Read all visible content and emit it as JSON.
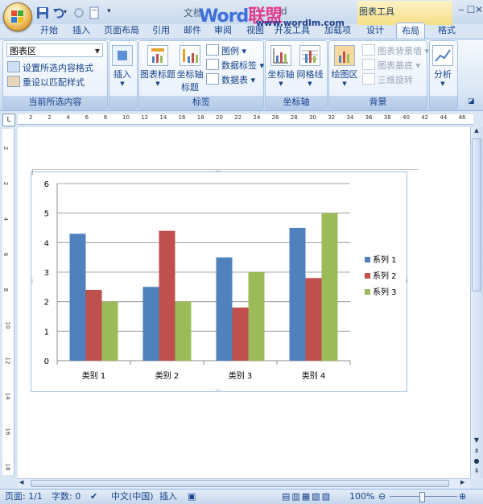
{
  "window": {
    "title": "文档",
    "title_suffix": "d",
    "watermark_a": "Word",
    "watermark_b": "联盟",
    "watermark_url": "www.wordlm.com",
    "contextual_group": "图表工具",
    "controls": [
      "‒",
      "☐",
      "✕"
    ]
  },
  "tabs": [
    {
      "label": "开始"
    },
    {
      "label": "插入"
    },
    {
      "label": "页面布局"
    },
    {
      "label": "引用"
    },
    {
      "label": "邮件"
    },
    {
      "label": "审阅"
    },
    {
      "label": "视图"
    },
    {
      "label": "开发工具"
    },
    {
      "label": "加载项"
    },
    {
      "label": "设计"
    },
    {
      "label": "布局"
    },
    {
      "label": "格式"
    }
  ],
  "ribbon": {
    "current_selection": {
      "combo_value": "图表区",
      "format_selection": "设置所选内容格式",
      "reset_style": "重设以匹配样式",
      "group_label": "当前所选内容"
    },
    "insert": {
      "label": "插入"
    },
    "labels": {
      "chart_title": "图表标题",
      "axis_title_1": "坐标轴",
      "axis_title_2": "标题",
      "legend": "图例",
      "data_labels": "数据标签",
      "data_table": "数据表",
      "group_label": "标签"
    },
    "axes": {
      "axes": "坐标轴",
      "gridlines": "网格线",
      "group_label": "坐标轴"
    },
    "background": {
      "plot_area": "绘图区",
      "chart_wall": "图表背景墙",
      "chart_floor": "图表基底",
      "rotation_3d": "三维旋转",
      "group_label": "背景"
    },
    "analysis": {
      "label": "分析"
    }
  },
  "ruler": {
    "h_ticks": [
      "2",
      "2",
      "4",
      "6",
      "8",
      "10",
      "12",
      "14",
      "16",
      "18",
      "20",
      "22",
      "24",
      "26",
      "28",
      "30",
      "32",
      "34",
      "36",
      "38",
      "40",
      "42",
      "44",
      "46"
    ],
    "v_ticks": [
      "2",
      "2",
      "4",
      "6",
      "8",
      "10",
      "12",
      "14",
      "16",
      "18"
    ]
  },
  "chart_data": {
    "type": "bar",
    "categories": [
      "类别 1",
      "类别 2",
      "类别 3",
      "类别 4"
    ],
    "series": [
      {
        "name": "系列 1",
        "values": [
          4.3,
          2.5,
          3.5,
          4.5
        ],
        "color": "#4f81bd"
      },
      {
        "name": "系列 2",
        "values": [
          2.4,
          4.4,
          1.8,
          2.8
        ],
        "color": "#c0504d"
      },
      {
        "name": "系列 3",
        "values": [
          2,
          2,
          3,
          5
        ],
        "color": "#9bbb59"
      }
    ],
    "yticks": [
      "0",
      "1",
      "2",
      "3",
      "4",
      "5",
      "6"
    ],
    "ylim": [
      0,
      6
    ],
    "grid": true,
    "legend": "right"
  },
  "status": {
    "page": "页面: 1/1",
    "words": "字数: 0",
    "language": "中文(中国)",
    "insert_mode": "插入",
    "zoom": "100%"
  }
}
